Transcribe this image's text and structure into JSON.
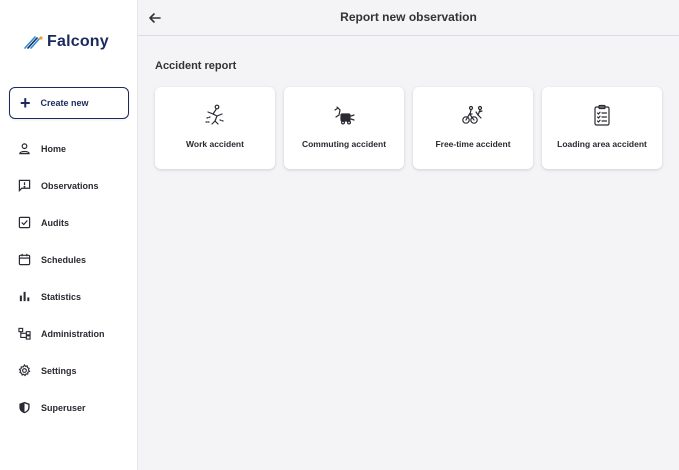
{
  "app": {
    "logo_text": "Falcony"
  },
  "sidebar": {
    "create_label": "Create new",
    "items": [
      {
        "label": "Home",
        "icon": "person-icon"
      },
      {
        "label": "Observations",
        "icon": "alert-message-icon"
      },
      {
        "label": "Audits",
        "icon": "check-box-icon"
      },
      {
        "label": "Schedules",
        "icon": "calendar-icon"
      },
      {
        "label": "Statistics",
        "icon": "bar-chart-icon"
      },
      {
        "label": "Administration",
        "icon": "hierarchy-icon"
      },
      {
        "label": "Settings",
        "icon": "gear-icon"
      },
      {
        "label": "Superuser",
        "icon": "shield-icon"
      }
    ]
  },
  "header": {
    "title": "Report new observation"
  },
  "main": {
    "section_title": "Accident report",
    "cards": [
      {
        "label": "Work accident",
        "icon": "falling-person-icon"
      },
      {
        "label": "Commuting accident",
        "icon": "vehicle-collision-icon"
      },
      {
        "label": "Free-time accident",
        "icon": "cyclist-collision-icon"
      },
      {
        "label": "Loading area accident",
        "icon": "clipboard-checklist-icon"
      }
    ]
  },
  "colors": {
    "brand": "#1b2a5e",
    "accent": "#2e8fd8",
    "background": "#f4f4f6"
  }
}
